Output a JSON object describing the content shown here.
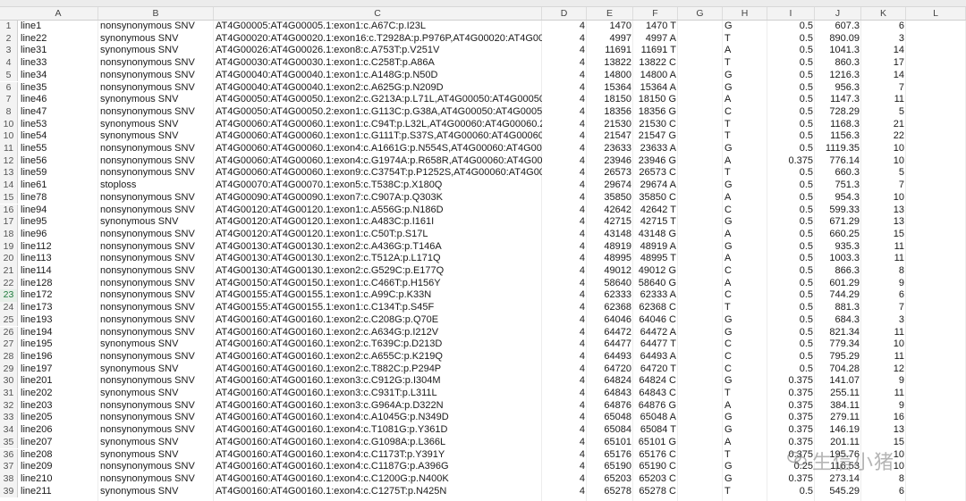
{
  "columns": [
    "A",
    "B",
    "C",
    "D",
    "E",
    "F",
    "G",
    "H",
    "I",
    "J",
    "K",
    "L"
  ],
  "selected_row": 23,
  "watermark": "生信小猪",
  "rows": [
    [
      "1",
      "line1",
      "nonsynonymous SNV",
      "AT4G00005:AT4G00005.1:exon1:c.A67C:p.I23L",
      "4",
      "1470",
      "1470 T",
      "G",
      "0.5",
      "607.3",
      "6"
    ],
    [
      "2",
      "line22",
      "synonymous SNV",
      "AT4G00020:AT4G00020.1:exon16:c.T2928A:p.P976P,AT4G00020:AT4G00020.3",
      "4",
      "4997",
      "4997 A",
      "T",
      "0.5",
      "890.09",
      "3"
    ],
    [
      "3",
      "line31",
      "synonymous SNV",
      "AT4G00026:AT4G00026.1:exon8:c.A753T:p.V251V",
      "4",
      "11691",
      "11691 T",
      "A",
      "0.5",
      "1041.3",
      "14"
    ],
    [
      "4",
      "line33",
      "nonsynonymous SNV",
      "AT4G00030:AT4G00030.1:exon1:c.C258T:p.A86A",
      "4",
      "13822",
      "13822 C",
      "T",
      "0.5",
      "860.3",
      "17"
    ],
    [
      "5",
      "line34",
      "nonsynonymous SNV",
      "AT4G00040:AT4G00040.1:exon1:c.A148G:p.N50D",
      "4",
      "14800",
      "14800 A",
      "G",
      "0.5",
      "1216.3",
      "14"
    ],
    [
      "6",
      "line35",
      "nonsynonymous SNV",
      "AT4G00040:AT4G00040.1:exon2:c.A625G:p.N209D",
      "4",
      "15364",
      "15364 A",
      "G",
      "0.5",
      "956.3",
      "7"
    ],
    [
      "7",
      "line46",
      "synonymous SNV",
      "AT4G00050:AT4G00050.1:exon2:c.G213A:p.L71L,AT4G00050:AT4G00050.3:exon",
      "4",
      "18150",
      "18150 G",
      "A",
      "0.5",
      "1147.3",
      "11"
    ],
    [
      "8",
      "line47",
      "nonsynonymous SNV",
      "AT4G00050:AT4G00050.2:exon1:c.G113C:p.G38A,AT4G00050:AT4G00050.1:ex",
      "4",
      "18356",
      "18356 G",
      "C",
      "0.5",
      "728.29",
      "5"
    ],
    [
      "10",
      "line53",
      "synonymous SNV",
      "AT4G00060:AT4G00060.1:exon1:c.C94T:p.L32L,AT4G00060:AT4G00060.2:exon",
      "4",
      "21530",
      "21530 C",
      "T",
      "0.5",
      "1168.3",
      "21"
    ],
    [
      "10",
      "line54",
      "synonymous SNV",
      "AT4G00060:AT4G00060.1:exon1:c.G111T:p.S37S,AT4G00060:AT4G00060.2:exo",
      "4",
      "21547",
      "21547 G",
      "T",
      "0.5",
      "1156.3",
      "22"
    ],
    [
      "11",
      "line55",
      "nonsynonymous SNV",
      "AT4G00060:AT4G00060.1:exon4:c.A1661G:p.N554S,AT4G00060:AT4G00060.2",
      "4",
      "23633",
      "23633 A",
      "G",
      "0.5",
      "1119.35",
      "10"
    ],
    [
      "12",
      "line56",
      "nonsynonymous SNV",
      "AT4G00060:AT4G00060.1:exon4:c.G1974A:p.R658R,AT4G00060:AT4G00060.2",
      "4",
      "23946",
      "23946 G",
      "A",
      "0.375",
      "776.14",
      "10"
    ],
    [
      "13",
      "line59",
      "nonsynonymous SNV",
      "AT4G00060:AT4G00060.1:exon9:c.C3754T:p.P1252S,AT4G00060:AT4G00060.3",
      "4",
      "26573",
      "26573 C",
      "T",
      "0.5",
      "660.3",
      "5"
    ],
    [
      "14",
      "line61",
      "stoploss",
      "AT4G00070:AT4G00070.1:exon5:c.T538C:p.X180Q",
      "4",
      "29674",
      "29674 A",
      "G",
      "0.5",
      "751.3",
      "7"
    ],
    [
      "15",
      "line78",
      "nonsynonymous SNV",
      "AT4G00090:AT4G00090.1:exon7:c.C907A:p.Q303K",
      "4",
      "35850",
      "35850 C",
      "A",
      "0.5",
      "954.3",
      "10"
    ],
    [
      "16",
      "line94",
      "nonsynonymous SNV",
      "AT4G00120:AT4G00120.1:exon1:c.A556G:p.N186D",
      "4",
      "42642",
      "42642 T",
      "C",
      "0.5",
      "599.33",
      "13"
    ],
    [
      "17",
      "line95",
      "synonymous SNV",
      "AT4G00120:AT4G00120.1:exon1:c.A483C:p.I161I",
      "4",
      "42715",
      "42715 T",
      "G",
      "0.5",
      "671.29",
      "13"
    ],
    [
      "18",
      "line96",
      "nonsynonymous SNV",
      "AT4G00120:AT4G00120.1:exon1:c.C50T:p.S17L",
      "4",
      "43148",
      "43148 G",
      "A",
      "0.5",
      "660.25",
      "15"
    ],
    [
      "19",
      "line112",
      "nonsynonymous SNV",
      "AT4G00130:AT4G00130.1:exon2:c.A436G:p.T146A",
      "4",
      "48919",
      "48919 A",
      "G",
      "0.5",
      "935.3",
      "11"
    ],
    [
      "20",
      "line113",
      "nonsynonymous SNV",
      "AT4G00130:AT4G00130.1:exon2:c.T512A:p.L171Q",
      "4",
      "48995",
      "48995 T",
      "A",
      "0.5",
      "1003.3",
      "11"
    ],
    [
      "21",
      "line114",
      "nonsynonymous SNV",
      "AT4G00130:AT4G00130.1:exon2:c.G529C:p.E177Q",
      "4",
      "49012",
      "49012 G",
      "C",
      "0.5",
      "866.3",
      "8"
    ],
    [
      "22",
      "line128",
      "nonsynonymous SNV",
      "AT4G00150:AT4G00150.1:exon1:c.C466T:p.H156Y",
      "4",
      "58640",
      "58640 G",
      "A",
      "0.5",
      "601.29",
      "9"
    ],
    [
      "23",
      "line172",
      "nonsynonymous SNV",
      "AT4G00155:AT4G00155.1:exon1:c.A99C:p.K33N",
      "4",
      "62333",
      "62333 A",
      "C",
      "0.5",
      "744.29",
      "6"
    ],
    [
      "24",
      "line173",
      "nonsynonymous SNV",
      "AT4G00155:AT4G00155.1:exon1:c.C134T:p.S45F",
      "4",
      "62368",
      "62368 C",
      "T",
      "0.5",
      "881.3",
      "7"
    ],
    [
      "25",
      "line193",
      "nonsynonymous SNV",
      "AT4G00160:AT4G00160.1:exon2:c.C208G:p.Q70E",
      "4",
      "64046",
      "64046 C",
      "G",
      "0.5",
      "684.3",
      "3"
    ],
    [
      "26",
      "line194",
      "nonsynonymous SNV",
      "AT4G00160:AT4G00160.1:exon2:c.A634G:p.I212V",
      "4",
      "64472",
      "64472 A",
      "G",
      "0.5",
      "821.34",
      "11"
    ],
    [
      "27",
      "line195",
      "synonymous SNV",
      "AT4G00160:AT4G00160.1:exon2:c.T639C:p.D213D",
      "4",
      "64477",
      "64477 T",
      "C",
      "0.5",
      "779.34",
      "10"
    ],
    [
      "28",
      "line196",
      "nonsynonymous SNV",
      "AT4G00160:AT4G00160.1:exon2:c.A655C:p.K219Q",
      "4",
      "64493",
      "64493 A",
      "C",
      "0.5",
      "795.29",
      "11"
    ],
    [
      "29",
      "line197",
      "synonymous SNV",
      "AT4G00160:AT4G00160.1:exon2:c.T882C:p.P294P",
      "4",
      "64720",
      "64720 T",
      "C",
      "0.5",
      "704.28",
      "12"
    ],
    [
      "30",
      "line201",
      "nonsynonymous SNV",
      "AT4G00160:AT4G00160.1:exon3:c.C912G:p.I304M",
      "4",
      "64824",
      "64824 C",
      "G",
      "0.375",
      "141.07",
      "9"
    ],
    [
      "31",
      "line202",
      "synonymous SNV",
      "AT4G00160:AT4G00160.1:exon3:c.C931T:p.L311L",
      "4",
      "64843",
      "64843 C",
      "T",
      "0.375",
      "255.11",
      "11"
    ],
    [
      "32",
      "line203",
      "nonsynonymous SNV",
      "AT4G00160:AT4G00160.1:exon3:c.G964A:p.D322N",
      "4",
      "64876",
      "64876 G",
      "A",
      "0.375",
      "384.11",
      "9"
    ],
    [
      "33",
      "line205",
      "nonsynonymous SNV",
      "AT4G00160:AT4G00160.1:exon4:c.A1045G:p.N349D",
      "4",
      "65048",
      "65048 A",
      "G",
      "0.375",
      "279.11",
      "16"
    ],
    [
      "34",
      "line206",
      "nonsynonymous SNV",
      "AT4G00160:AT4G00160.1:exon4:c.T1081G:p.Y361D",
      "4",
      "65084",
      "65084 T",
      "G",
      "0.375",
      "146.19",
      "13"
    ],
    [
      "35",
      "line207",
      "synonymous SNV",
      "AT4G00160:AT4G00160.1:exon4:c.G1098A:p.L366L",
      "4",
      "65101",
      "65101 G",
      "A",
      "0.375",
      "201.11",
      "15"
    ],
    [
      "36",
      "line208",
      "synonymous SNV",
      "AT4G00160:AT4G00160.1:exon4:c.C1173T:p.Y391Y",
      "4",
      "65176",
      "65176 C",
      "T",
      "0.375",
      "195.76",
      "10"
    ],
    [
      "37",
      "line209",
      "nonsynonymous SNV",
      "AT4G00160:AT4G00160.1:exon4:c.C1187G:p.A396G",
      "4",
      "65190",
      "65190 C",
      "G",
      "0.25",
      "116.53",
      "10"
    ],
    [
      "38",
      "line210",
      "nonsynonymous SNV",
      "AT4G00160:AT4G00160.1:exon4:c.C1200G:p.N400K",
      "4",
      "65203",
      "65203 C",
      "G",
      "0.375",
      "273.14",
      "8"
    ],
    [
      "39",
      "line211",
      "synonymous SNV",
      "AT4G00160:AT4G00160.1:exon4:c.C1275T:p.N425N",
      "4",
      "65278",
      "65278 C",
      "T",
      "0.5",
      "545.29",
      "6"
    ]
  ]
}
